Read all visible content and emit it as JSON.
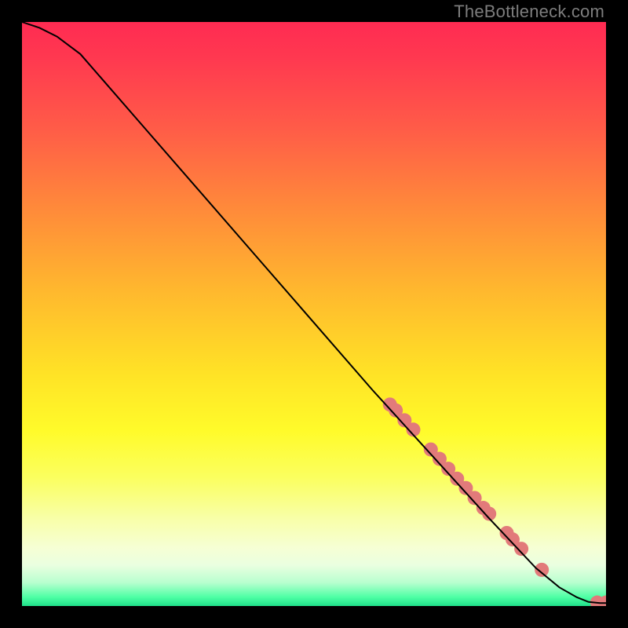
{
  "attribution": "TheBottleneck.com",
  "chart_data": {
    "type": "line",
    "title": "",
    "xlabel": "",
    "ylabel": "",
    "xlim": [
      0,
      100
    ],
    "ylim": [
      0,
      100
    ],
    "grid": false,
    "legend": false,
    "background": "red-yellow-green vertical gradient",
    "series": [
      {
        "name": "curve",
        "color": "#000000",
        "points_xy": [
          [
            0,
            100
          ],
          [
            3,
            99
          ],
          [
            6,
            97.5
          ],
          [
            10,
            94.5
          ],
          [
            20,
            83
          ],
          [
            30,
            71.5
          ],
          [
            40,
            60
          ],
          [
            50,
            48.5
          ],
          [
            60,
            37
          ],
          [
            70,
            26
          ],
          [
            80,
            15
          ],
          [
            88,
            6.5
          ],
          [
            92,
            3.2
          ],
          [
            95,
            1.5
          ],
          [
            97,
            0.7
          ],
          [
            99,
            0.5
          ],
          [
            100,
            0.5
          ]
        ]
      }
    ],
    "highlight_points": {
      "comment": "salmon-colored dot clusters on the curve",
      "color": "#e27a7a",
      "radius": 9,
      "points_xy": [
        [
          63,
          34.5
        ],
        [
          64,
          33.5
        ],
        [
          65.5,
          31.8
        ],
        [
          67,
          30.2
        ],
        [
          70,
          26.8
        ],
        [
          71.5,
          25.2
        ],
        [
          73,
          23.5
        ],
        [
          74.5,
          21.8
        ],
        [
          76,
          20.2
        ],
        [
          77.5,
          18.5
        ],
        [
          79,
          16.8
        ],
        [
          80,
          15.8
        ],
        [
          83,
          12.5
        ],
        [
          84,
          11.4
        ],
        [
          85.5,
          9.8
        ],
        [
          89,
          6.2
        ],
        [
          98.5,
          0.6
        ],
        [
          100,
          0.6
        ]
      ]
    }
  }
}
